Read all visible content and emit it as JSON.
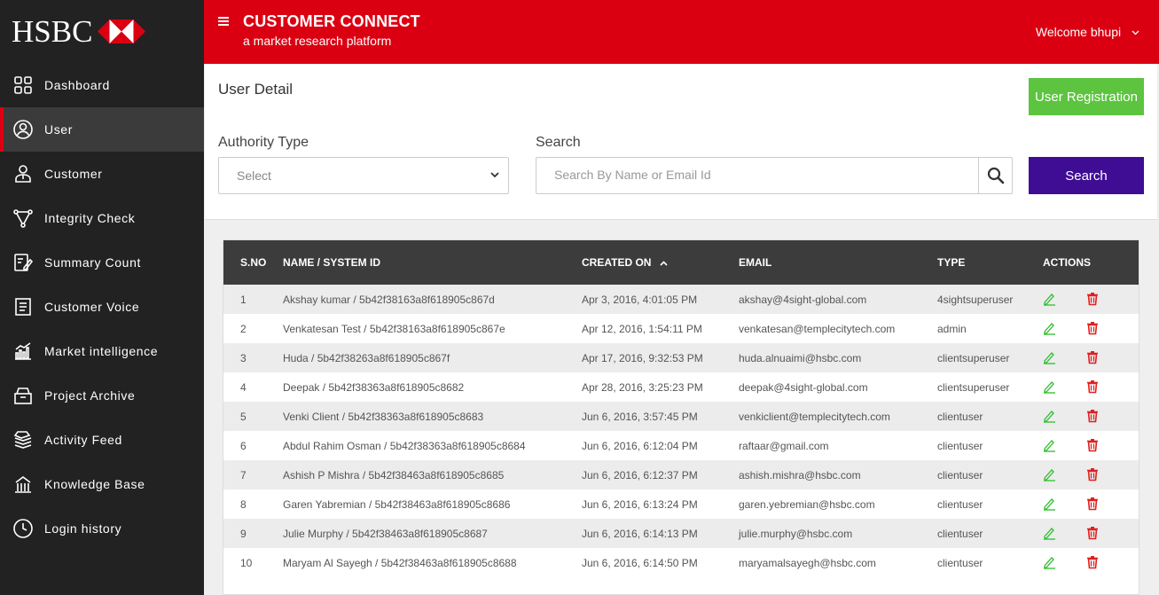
{
  "brand": {
    "logo_text": "HSBC"
  },
  "sidebar": {
    "items": [
      {
        "label": "Dashboard",
        "icon": "grid-icon"
      },
      {
        "label": "User",
        "icon": "user-circle-icon",
        "active": true
      },
      {
        "label": "Customer",
        "icon": "customer-icon"
      },
      {
        "label": "Integrity Check",
        "icon": "network-icon"
      },
      {
        "label": "Summary Count",
        "icon": "edit-doc-icon"
      },
      {
        "label": "Customer Voice",
        "icon": "list-doc-icon"
      },
      {
        "label": "Market intelligence",
        "icon": "bar-chart-icon"
      },
      {
        "label": "Project Archive",
        "icon": "archive-icon"
      },
      {
        "label": "Activity Feed",
        "icon": "stack-icon"
      },
      {
        "label": "Knowledge Base",
        "icon": "building-icon"
      },
      {
        "label": "Login history",
        "icon": "clock-icon"
      }
    ]
  },
  "header": {
    "title": "CUSTOMER CONNECT",
    "subtitle": "a market research platform",
    "welcome": "Welcome bhupi"
  },
  "panel": {
    "title": "User Detail",
    "registration_label": "User Registration",
    "authority_label": "Authority Type",
    "authority_value": "Select",
    "search_label": "Search",
    "search_placeholder": "Search By Name or Email Id",
    "search_button": "Search"
  },
  "table": {
    "headers": {
      "sno": "S.NO",
      "name": "NAME / SYSTEM ID",
      "created": "CREATED ON",
      "email": "EMAIL",
      "type": "TYPE",
      "actions": "ACTIONS"
    },
    "rows": [
      {
        "sno": "1",
        "name": "Akshay kumar / 5b42f38163a8f618905c867d",
        "created": "Apr 3, 2016, 4:01:05 PM",
        "email": "akshay@4sight-global.com",
        "type": "4sightsuperuser"
      },
      {
        "sno": "2",
        "name": "Venkatesan Test / 5b42f38163a8f618905c867e",
        "created": "Apr 12, 2016, 1:54:11 PM",
        "email": "venkatesan@templecitytech.com",
        "type": "admin"
      },
      {
        "sno": "3",
        "name": "Huda / 5b42f38263a8f618905c867f",
        "created": "Apr 17, 2016, 9:32:53 PM",
        "email": "huda.alnuaimi@hsbc.com",
        "type": "clientsuperuser"
      },
      {
        "sno": "4",
        "name": "Deepak / 5b42f38363a8f618905c8682",
        "created": "Apr 28, 2016, 3:25:23 PM",
        "email": "deepak@4sight-global.com",
        "type": "clientsuperuser"
      },
      {
        "sno": "5",
        "name": "Venki Client / 5b42f38363a8f618905c8683",
        "created": "Jun 6, 2016, 3:57:45 PM",
        "email": "venkiclient@templecitytech.com",
        "type": "clientuser"
      },
      {
        "sno": "6",
        "name": "Abdul Rahim Osman / 5b42f38363a8f618905c8684",
        "created": "Jun 6, 2016, 6:12:04 PM",
        "email": "raftaar@gmail.com",
        "type": "clientuser"
      },
      {
        "sno": "7",
        "name": "Ashish P Mishra / 5b42f38463a8f618905c8685",
        "created": "Jun 6, 2016, 6:12:37 PM",
        "email": "ashish.mishra@hsbc.com",
        "type": "clientuser"
      },
      {
        "sno": "8",
        "name": "Garen Yabremian / 5b42f38463a8f618905c8686",
        "created": "Jun 6, 2016, 6:13:24 PM",
        "email": "garen.yebremian@hsbc.com",
        "type": "clientuser"
      },
      {
        "sno": "9",
        "name": "Julie Murphy / 5b42f38463a8f618905c8687",
        "created": "Jun 6, 2016, 6:14:13 PM",
        "email": "julie.murphy@hsbc.com",
        "type": "clientuser"
      },
      {
        "sno": "10",
        "name": "Maryam Al Sayegh / 5b42f38463a8f618905c8688",
        "created": "Jun 6, 2016, 6:14:50 PM",
        "email": "maryamalsayegh@hsbc.com",
        "type": "clientuser"
      }
    ]
  },
  "colors": {
    "brand_red": "#db0011",
    "sidebar_bg": "#222222",
    "registration_green": "#5cc43f",
    "search_purple": "#3e0d94",
    "edit_green": "#2dbe2d",
    "delete_red": "#e02020"
  }
}
